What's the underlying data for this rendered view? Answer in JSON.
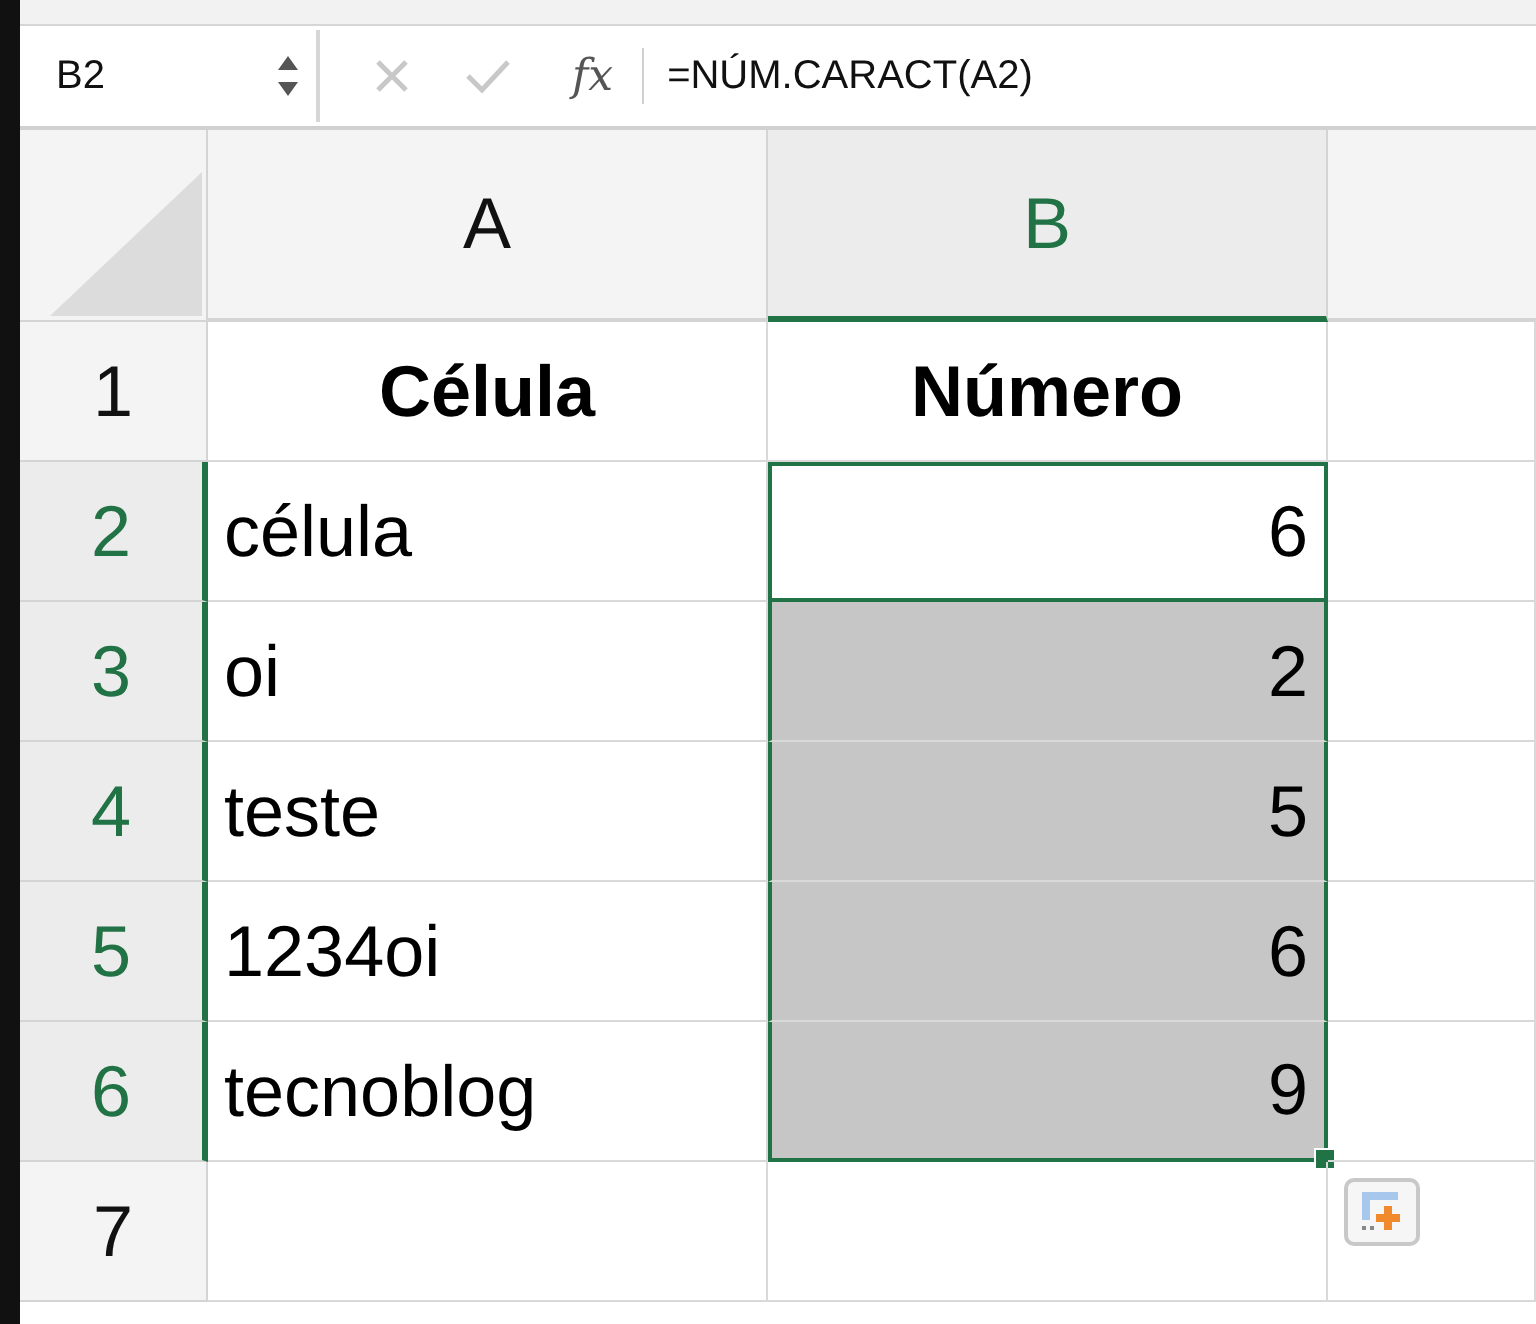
{
  "formula_bar": {
    "name_box": "B2",
    "fx": "fx",
    "formula": "=NÚM.CARACT(A2)"
  },
  "columns": [
    {
      "label": "A",
      "selected": false
    },
    {
      "label": "B",
      "selected": true
    }
  ],
  "rows": [
    {
      "number": "1",
      "kind": "header",
      "selected": false,
      "cells": [
        {
          "text": "Célula",
          "selected": false,
          "active": false
        },
        {
          "text": "Número",
          "selected": false,
          "active": false
        }
      ]
    },
    {
      "number": "2",
      "kind": "data",
      "selected": true,
      "cells": [
        {
          "text": "célula",
          "selected": false,
          "active": false
        },
        {
          "text": "6",
          "selected": true,
          "active": true
        }
      ]
    },
    {
      "number": "3",
      "kind": "data",
      "selected": true,
      "cells": [
        {
          "text": "oi",
          "selected": false,
          "active": false
        },
        {
          "text": "2",
          "selected": true,
          "active": false
        }
      ]
    },
    {
      "number": "4",
      "kind": "data",
      "selected": true,
      "cells": [
        {
          "text": "teste",
          "selected": false,
          "active": false
        },
        {
          "text": "5",
          "selected": true,
          "active": false
        }
      ]
    },
    {
      "number": "5",
      "kind": "data",
      "selected": true,
      "cells": [
        {
          "text": "1234oi",
          "selected": false,
          "active": false
        },
        {
          "text": "6",
          "selected": true,
          "active": false
        }
      ]
    },
    {
      "number": "6",
      "kind": "data",
      "selected": true,
      "cells": [
        {
          "text": "tecnoblog",
          "selected": false,
          "active": false
        },
        {
          "text": "9",
          "selected": true,
          "active": false
        }
      ]
    },
    {
      "number": "7",
      "kind": "data",
      "selected": false,
      "cells": []
    }
  ]
}
